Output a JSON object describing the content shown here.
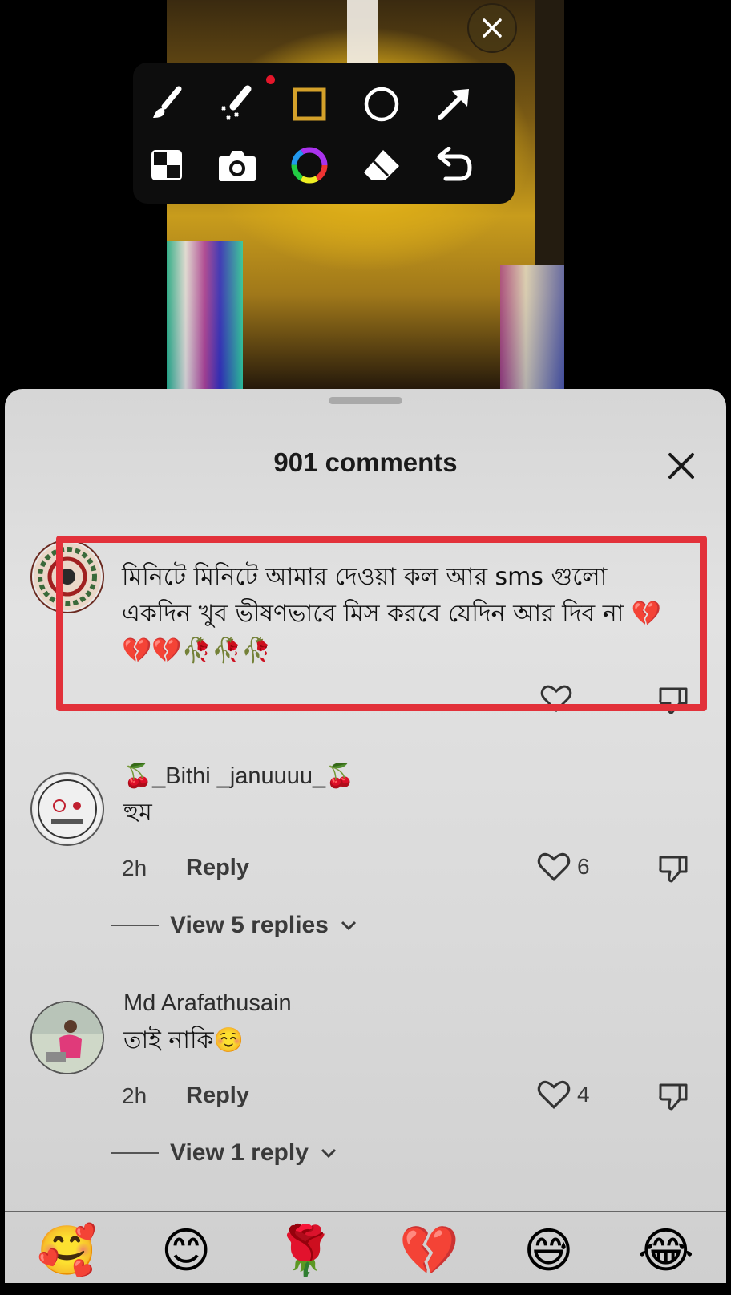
{
  "video": {},
  "toolbar": {
    "tools": [
      "brush-icon",
      "magic-pen-icon",
      "rectangle-icon",
      "circle-icon",
      "arrow-icon",
      "mosaic-icon",
      "camera-icon",
      "color-wheel-icon",
      "eraser-icon",
      "undo-icon"
    ]
  },
  "sheet": {
    "title": "901 comments"
  },
  "comments": [
    {
      "text": "মিনিটে মিনিটে আমার দেওয়া কল আর sms গুলো একদিন খুব ভীষণভাবে মিস করবে যেদিন আর দিব না 💔💔💔🥀🥀🥀"
    },
    {
      "username": "🍒_Bithi _januuuu_🍒",
      "text": "হুম",
      "time": "2h",
      "reply": "Reply",
      "likes": "6",
      "view_replies": "View 5 replies"
    },
    {
      "username": "Md Arafathusain",
      "text": "তাই নাকি☺️",
      "time": "2h",
      "reply": "Reply",
      "likes": "4",
      "view_replies": "View 1 reply"
    }
  ],
  "emoji_bar": [
    "🥰",
    "😊",
    "🌹",
    "💔",
    "😅",
    "😂"
  ],
  "colors": {
    "highlight": "#e2313a",
    "toolbar_accent": "#d4a12a"
  }
}
